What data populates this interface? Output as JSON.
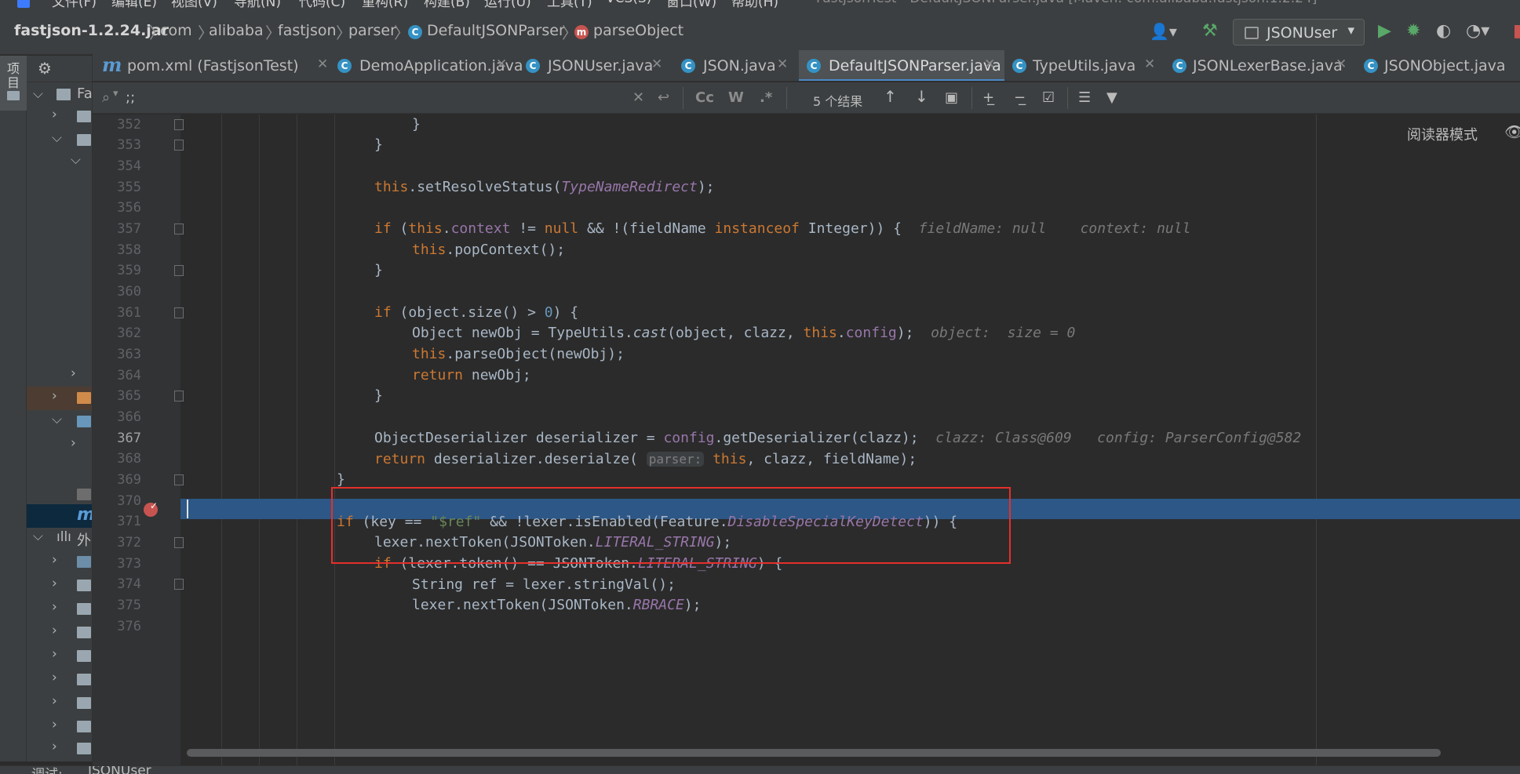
{
  "menu": {
    "items": [
      "文件(F)",
      "编辑(E)",
      "视图(V)",
      "导航(N)",
      "代码(C)",
      "重构(R)",
      "构建(B)",
      "运行(U)",
      "工具(T)",
      "VCS(S)",
      "窗口(W)",
      "帮助(H)"
    ],
    "window_title": "FastjsonTest - DefaultJSONParser.java [Maven: com.alibaba:fastjson:1.2.24]"
  },
  "breadcrumb": {
    "jar": "fastjson-1.2.24.jar",
    "pkg1": "com",
    "pkg2": "alibaba",
    "pkg3": "fastjson",
    "pkg4": "parser",
    "class": "DefaultJSONParser",
    "method": "parseObject"
  },
  "run_config": {
    "label": "JSONUser",
    "dropdown": "▾"
  },
  "left_strip": {
    "project_label": "项目"
  },
  "project_tree": {
    "root_label": "Fa",
    "external_label": "外"
  },
  "tabs": [
    {
      "label": "pom.xml (FastjsonTest)",
      "icon": "maven-icon"
    },
    {
      "label": "DemoApplication.java",
      "icon": "class-icon"
    },
    {
      "label": "JSONUser.java",
      "icon": "class-icon"
    },
    {
      "label": "JSON.java",
      "icon": "class-icon"
    },
    {
      "label": "DefaultJSONParser.java",
      "icon": "class-icon",
      "active": true
    },
    {
      "label": "TypeUtils.java",
      "icon": "class-icon"
    },
    {
      "label": "JSONLexerBase.java",
      "icon": "class-icon"
    },
    {
      "label": "JSONObject.java",
      "icon": "class-icon"
    }
  ],
  "find": {
    "query": ";;",
    "result_count": "5 个结果",
    "match_case": "Cc",
    "words": "W",
    "regex": ".*"
  },
  "editor": {
    "reader_mode": "阅读器模式",
    "current_line": 367,
    "line_numbers": [
      "352",
      "353",
      "354",
      "355",
      "356",
      "357",
      "358",
      "359",
      "360",
      "361",
      "362",
      "363",
      "364",
      "365",
      "366",
      "367",
      "368",
      "369",
      "370",
      "371",
      "372",
      "373",
      "374",
      "375",
      "376"
    ],
    "hints": {
      "l357a": "fieldName: null",
      "l357b": "context: null",
      "l362": "object:  size = 0",
      "l367a": "clazz: Class@609",
      "l367b": "config: ParserConfig@582",
      "l368_param": "parser:"
    }
  },
  "bottom": {
    "label1": "调试:",
    "label2": "JSONUser"
  },
  "colors": {
    "keyword": "#cc7832",
    "field": "#9876aa",
    "number": "#6897bb",
    "string": "#6a8759",
    "selection": "#2d5786",
    "annotation_box": "#e5302b"
  }
}
